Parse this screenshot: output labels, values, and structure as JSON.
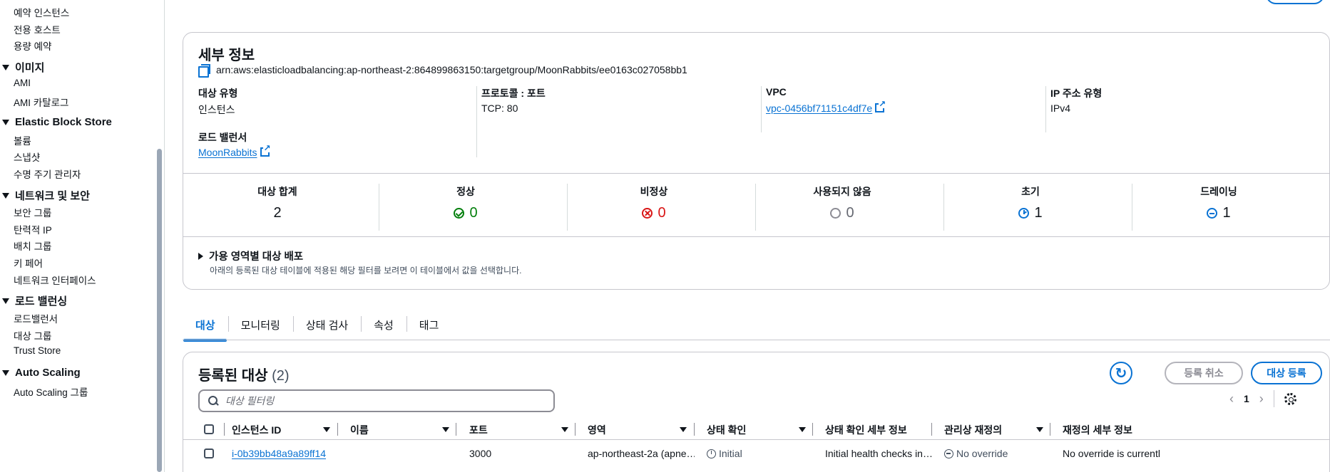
{
  "sidebar": {
    "items_top": [
      "예약 인스턴스",
      "전용 호스트",
      "용량 예약"
    ],
    "groups": [
      {
        "title": "이미지",
        "items": [
          "AMI",
          "AMI 카탈로그"
        ]
      },
      {
        "title": "Elastic Block Store",
        "items": [
          "볼륨",
          "스냅샷",
          "수명 주기 관리자"
        ]
      },
      {
        "title": "네트워크 및 보안",
        "items": [
          "보안 그룹",
          "탄력적 IP",
          "배치 그룹",
          "키 페어",
          "네트워크 인터페이스"
        ]
      },
      {
        "title": "로드 밸런싱",
        "items": [
          "로드밸런서",
          "대상 그룹",
          "Trust Store"
        ]
      },
      {
        "title": "Auto Scaling",
        "items": [
          "Auto Scaling 그룹"
        ]
      }
    ]
  },
  "details": {
    "title": "세부 정보",
    "arn": "arn:aws:elasticloadbalancing:ap-northeast-2:864899863150:targetgroup/MoonRabbits/ee0163c027058bb1",
    "target_type_label": "대상 유형",
    "target_type_value": "인스턴스",
    "protocol_label": "프로토콜 : 포트",
    "protocol_value": "TCP: 80",
    "vpc_label": "VPC",
    "vpc_value": "vpc-0456bf71151c4df7e",
    "ip_type_label": "IP 주소 유형",
    "ip_type_value": "IPv4",
    "lb_label": "로드 밸런서",
    "lb_value": "MoonRabbits"
  },
  "stats": [
    {
      "label": "대상 합계",
      "value": "2"
    },
    {
      "label": "정상",
      "value": "0"
    },
    {
      "label": "비정상",
      "value": "0"
    },
    {
      "label": "사용되지 않음",
      "value": "0"
    },
    {
      "label": "초기",
      "value": "1"
    },
    {
      "label": "드레이닝",
      "value": "1"
    }
  ],
  "az": {
    "title": "가용 영역별 대상 배포",
    "description": "아래의 등록된 대상 테이블에 적용된 해당 필터를 보려면 이 테이블에서 값을 선택합니다."
  },
  "tabs": [
    "대상",
    "모니터링",
    "상태 검사",
    "속성",
    "태그"
  ],
  "targets": {
    "title": "등록된 대상",
    "count": "(2)",
    "deregister_label": "등록 취소",
    "register_label": "대상 등록",
    "filter_placeholder": "대상 필터링",
    "page": "1",
    "columns": [
      "인스턴스 ID",
      "이름",
      "포트",
      "영역",
      "상태 확인",
      "상태 확인 세부 정보",
      "관리상 재정의",
      "재정의 세부 정보"
    ],
    "rows": [
      {
        "instance_id": "i-0b39bb48a9a89ff14",
        "name": "",
        "port": "3000",
        "zone": "ap-northeast-2a (apne…",
        "health": "Initial",
        "health_details": "Initial health checks in…",
        "override": "No override",
        "override_details": "No override is currentl"
      }
    ]
  },
  "colors": {
    "accent": "#0972d3",
    "success": "#037f0c",
    "error": "#d91515",
    "border": "#c6c6cd"
  },
  "icons": [
    "copy-icon",
    "external-link-icon",
    "success-icon",
    "error-icon",
    "unused-icon",
    "clock-icon",
    "drain-icon",
    "refresh-icon",
    "search-icon",
    "chevron-left-icon",
    "chevron-right-icon",
    "gear-icon"
  ]
}
